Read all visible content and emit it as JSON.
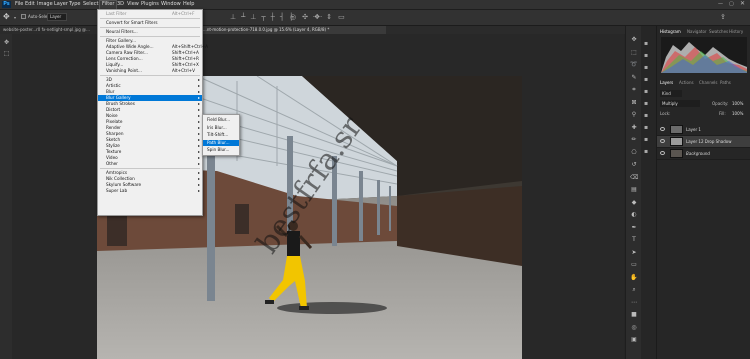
{
  "menubar": {
    "logo": "Ps",
    "items": [
      "File",
      "Edit",
      "Image",
      "Layer",
      "Type",
      "Select",
      "Filter",
      "3D",
      "View",
      "Plugins",
      "Window",
      "Help"
    ],
    "active": "Filter"
  },
  "options": {
    "auto_select_label": "Auto-Select:",
    "auto_select_value": "Layer"
  },
  "tabs": [
    {
      "label": "website-poster...r0 fx-netlight-smpl.jpg @..."
    },
    {
      "label": "...nt-motion-protection-718.0.0.jpg @ 15.6% (Layer 4, RGB/8) *"
    }
  ],
  "filter_menu": {
    "items": [
      {
        "label": "Last Filter",
        "shortcut": "Alt+Ctrl+F",
        "disabled": true
      },
      {
        "sep": true
      },
      {
        "label": "Convert for Smart Filters"
      },
      {
        "sep": true
      },
      {
        "label": "Neural Filters..."
      },
      {
        "sep": true
      },
      {
        "label": "Filter Gallery..."
      },
      {
        "label": "Adaptive Wide Angle...",
        "shortcut": "Alt+Shift+Ctrl+A"
      },
      {
        "label": "Camera Raw Filter...",
        "shortcut": "Shift+Ctrl+A"
      },
      {
        "label": "Lens Correction...",
        "shortcut": "Shift+Ctrl+R"
      },
      {
        "label": "Liquify...",
        "shortcut": "Shift+Ctrl+X"
      },
      {
        "label": "Vanishing Point...",
        "shortcut": "Alt+Ctrl+V"
      },
      {
        "sep": true
      },
      {
        "label": "3D",
        "submenu": true
      },
      {
        "label": "Artistic",
        "submenu": true
      },
      {
        "label": "Blur",
        "submenu": true
      },
      {
        "label": "Blur Gallery",
        "submenu": true,
        "highlighted": true
      },
      {
        "label": "Brush Strokes",
        "submenu": true
      },
      {
        "label": "Distort",
        "submenu": true
      },
      {
        "label": "Noise",
        "submenu": true
      },
      {
        "label": "Pixelate",
        "submenu": true
      },
      {
        "label": "Render",
        "submenu": true
      },
      {
        "label": "Sharpen",
        "submenu": true
      },
      {
        "label": "Sketch",
        "submenu": true
      },
      {
        "label": "Stylize",
        "submenu": true
      },
      {
        "label": "Texture",
        "submenu": true
      },
      {
        "label": "Video",
        "submenu": true
      },
      {
        "label": "Other",
        "submenu": true
      },
      {
        "sep": true
      },
      {
        "label": "Amtropics",
        "submenu": true
      },
      {
        "label": "Nik Collection",
        "submenu": true
      },
      {
        "label": "Skylum Software",
        "submenu": true
      },
      {
        "label": "Super Lab",
        "submenu": true
      }
    ]
  },
  "blur_gallery_submenu": {
    "items": [
      {
        "label": "Field Blur..."
      },
      {
        "label": "Iris Blur..."
      },
      {
        "label": "Tilt-Shift..."
      },
      {
        "label": "Path Blur...",
        "highlighted": true
      },
      {
        "label": "Spin Blur..."
      }
    ]
  },
  "panels": {
    "top_tabs": [
      "Histogram",
      "Navigator",
      "Swatches",
      "History"
    ],
    "layer_tabs": [
      "Layers",
      "Actions",
      "Channels",
      "Paths"
    ],
    "kind_label": "Kind",
    "blend_mode": "Multiply",
    "opacity_label": "Opacity:",
    "opacity_value": "100%",
    "fill_label": "Fill:",
    "fill_value": "100%",
    "lock_label": "Lock:",
    "layers": [
      {
        "name": "Layer 1",
        "selected": false
      },
      {
        "name": "Layer 12 Drop Shadow",
        "selected": true
      },
      {
        "name": "Background",
        "selected": false,
        "italic": true
      }
    ]
  },
  "watermark": "bestfrfa.sr",
  "colors": {
    "highlight": "#0078d7",
    "ps_blue": "#31a8ff",
    "pants": "#f2c500"
  },
  "icons": {
    "move": "move-icon",
    "eye": "eye-icon"
  }
}
